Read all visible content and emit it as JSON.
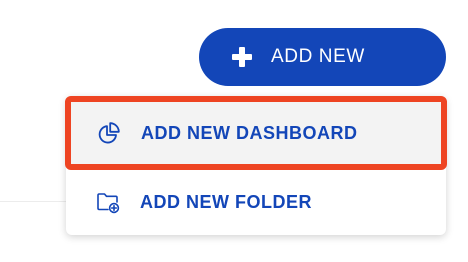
{
  "add_new_button": {
    "label": "ADD NEW",
    "icon": "plus-icon",
    "color": "#1346b8"
  },
  "menu": {
    "items": [
      {
        "label": "ADD NEW DASHBOARD",
        "icon": "pie-chart-icon",
        "highlighted": true
      },
      {
        "label": "ADD NEW FOLDER",
        "icon": "folder-add-icon",
        "highlighted": false
      }
    ],
    "highlight_color": "#ee4422",
    "text_color": "#1346b8"
  }
}
